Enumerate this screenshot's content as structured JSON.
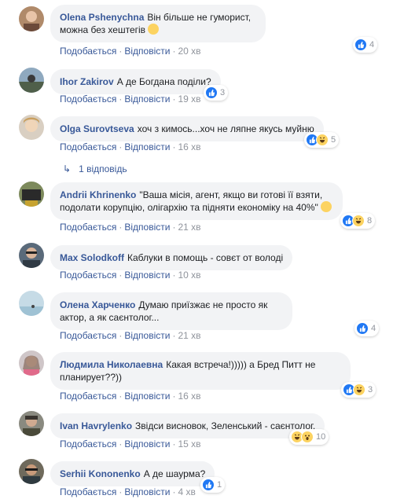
{
  "labels": {
    "like": "Подобається",
    "reply": "Відповісти",
    "dot": "·"
  },
  "reply_thread": {
    "arrow": "↳",
    "text": "1 відповідь"
  },
  "comments": [
    {
      "author": "Olena Pshenychna",
      "text": "Він більше не гуморист, можна без хештегів",
      "time": "20 хв",
      "reactions": [
        "like"
      ],
      "count": "4"
    },
    {
      "author": "Ihor Zakirov",
      "text": "А де Богдана поділи?",
      "time": "19 хв",
      "reactions": [
        "like"
      ],
      "count": "3"
    },
    {
      "author": "Olga Surovtseva",
      "text": "хоч з кимось...хоч не ляпне якусь муйню",
      "time": "16 хв",
      "reactions": [
        "like",
        "haha"
      ],
      "count": "5"
    },
    {
      "author": "Andrii Khrinenko",
      "text": "\"Ваша місія, агент, якщо ви готові її взяти, подолати корупцію, олігархію та підняти економіку на 40%\"",
      "time": "21 хв",
      "reactions": [
        "like",
        "haha"
      ],
      "count": "8"
    },
    {
      "author": "Max Solodkoff",
      "text": "Каблуки в помощь - совєт от володі",
      "time": "10 хв",
      "reactions": [],
      "count": ""
    },
    {
      "author": "Олена Харченко",
      "text": "Думаю приїзжає не просто як актор, а як саєнтолог...",
      "time": "21 хв",
      "reactions": [
        "like"
      ],
      "count": "4"
    },
    {
      "author": "Людмила Николаевна",
      "text": "Какая встреча!))))) а Бред Питт не планирует??))",
      "time": "16 хв",
      "reactions": [
        "like",
        "haha"
      ],
      "count": "3"
    },
    {
      "author": "Ivan Havrylenko",
      "text": "Звідси висновок, Зеленський - саєнтолог.",
      "time": "15 хв",
      "reactions": [
        "haha",
        "wow"
      ],
      "count": "10"
    },
    {
      "author": "Serhii Kononenko",
      "text": "А де шаурма?",
      "time": "4 хв",
      "reactions": [
        "like"
      ],
      "count": "1"
    }
  ],
  "colors": {
    "link": "#385898",
    "bubble": "#f2f3f5",
    "like": "#2078f4",
    "emoji": "#fcd361"
  }
}
